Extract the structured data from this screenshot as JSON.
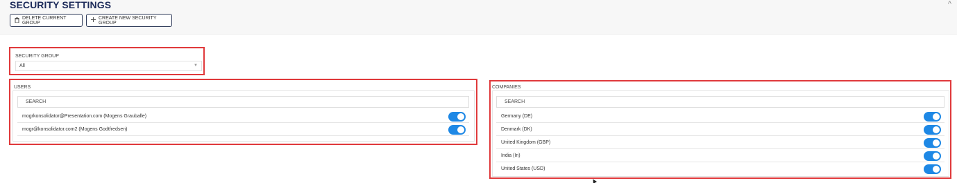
{
  "header": {
    "title": "SECURITY SETTINGS",
    "collapse_icon": "^",
    "buttons": {
      "delete_label": "DELETE CURRENT GROUP",
      "delete_icon": "trash-icon",
      "create_label": "CREATE NEW SECURITY GROUP",
      "create_icon": "plus-icon"
    }
  },
  "security_group": {
    "label": "SECURITY GROUP",
    "selected": "All"
  },
  "users": {
    "label": "USERS",
    "search_placeholder": "SEARCH",
    "items": [
      {
        "label": "mogrkonsolidator@Presentation.com (Mogens Grauballe)",
        "enabled": true
      },
      {
        "label": "mogr@konsolidator.com2 (Mogens Godtfredsen)",
        "enabled": true
      }
    ]
  },
  "companies": {
    "label": "COMPANIES",
    "search_placeholder": "SEARCH",
    "items": [
      {
        "label": "Germany (DE)",
        "enabled": true
      },
      {
        "label": "Denmark (DK)",
        "enabled": true
      },
      {
        "label": "United Kingdom (GBP)",
        "enabled": true
      },
      {
        "label": "India (In)",
        "enabled": true
      },
      {
        "label": "United States (USD)",
        "enabled": true
      }
    ]
  },
  "colors": {
    "accent": "#1e88e5",
    "title": "#1d2b5a",
    "highlight": "#e0393b"
  }
}
